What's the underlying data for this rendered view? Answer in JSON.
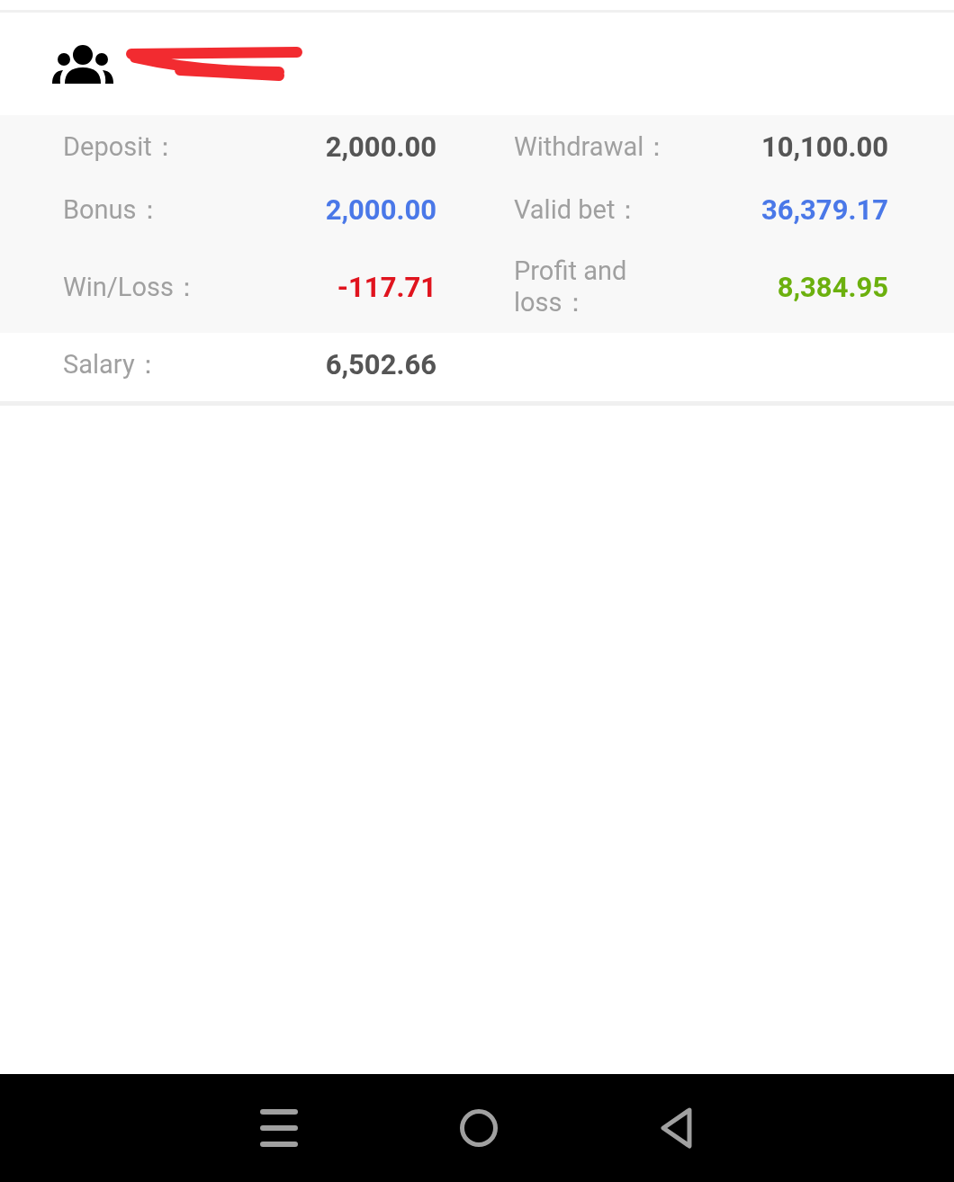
{
  "rows": [
    {
      "cells": [
        {
          "label": "Deposit：",
          "value": "2,000.00",
          "color": "#555555"
        },
        {
          "label": "Withdrawal：",
          "value": "10,100.00",
          "color": "#555555"
        }
      ]
    },
    {
      "cells": [
        {
          "label": "Bonus：",
          "value": "2,000.00",
          "color": "#4a78e8"
        },
        {
          "label": "Valid bet：",
          "value": "36,379.17",
          "color": "#4a78e8"
        }
      ]
    },
    {
      "cells": [
        {
          "label": "Win/Loss：",
          "value": "-117.71",
          "color": "#e0141e"
        },
        {
          "label": "Profit and loss：",
          "value": "8,384.95",
          "color": "#6cb00e"
        }
      ]
    },
    {
      "cells": [
        {
          "label": "Salary：",
          "value": "6,502.66",
          "color": "#555555"
        }
      ]
    }
  ]
}
